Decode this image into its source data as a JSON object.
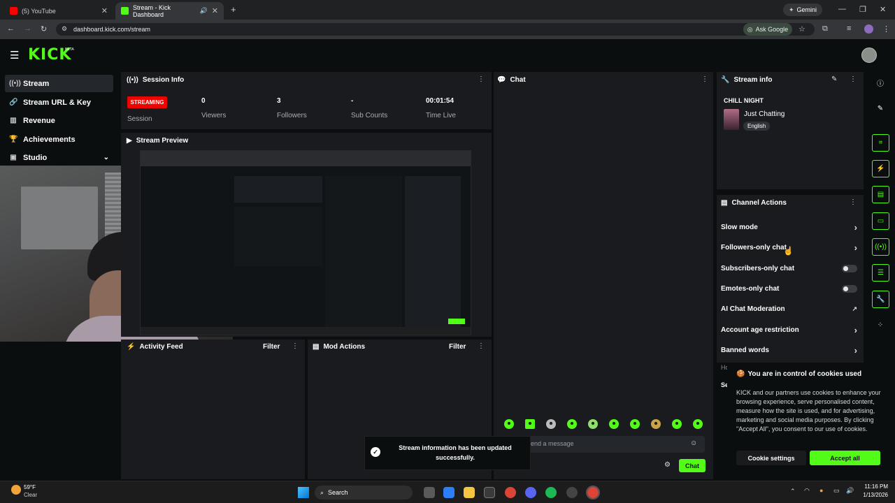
{
  "browser": {
    "tabs": [
      {
        "label": "(5) YouTube",
        "active": false
      },
      {
        "label": "Stream - Kick Dashboard",
        "active": true
      }
    ],
    "gemini_label": "Gemini",
    "url": "dashboard.kick.com/stream",
    "ask_google": "Ask Google"
  },
  "brand": {
    "logo": "KICK",
    "beta": "BETA",
    "accent": "#53fc18",
    "live_red": "#eb0400"
  },
  "sidebar": {
    "items": [
      {
        "label": "Stream",
        "icon": "broadcast-icon",
        "active": true
      },
      {
        "label": "Stream URL & Key",
        "icon": "link-icon",
        "active": false
      },
      {
        "label": "Revenue",
        "icon": "chart-icon",
        "active": false
      },
      {
        "label": "Achievements",
        "icon": "trophy-icon",
        "active": false
      },
      {
        "label": "Studio",
        "icon": "camera-icon",
        "active": false
      }
    ]
  },
  "session": {
    "title": "Session Info",
    "status_badge": "STREAMING",
    "status_label": "Session",
    "stats": [
      {
        "value": "0",
        "label": "Viewers"
      },
      {
        "value": "3",
        "label": "Followers"
      },
      {
        "value": "-",
        "label": "Sub Counts"
      },
      {
        "value": "00:01:54",
        "label": "Time Live"
      }
    ]
  },
  "preview": {
    "title": "Stream Preview"
  },
  "chat": {
    "title": "Chat",
    "input_placeholder": "end a message",
    "send_label": "Chat"
  },
  "activity_feed": {
    "title": "Activity Feed",
    "filter_label": "Filter"
  },
  "mod_actions": {
    "title": "Mod Actions",
    "filter_label": "Filter"
  },
  "stream_info": {
    "title": "Stream info",
    "stream_title": "CHILL NIGHT",
    "category": "Just Chatting",
    "language": "English"
  },
  "channel_actions": {
    "title": "Channel Actions",
    "rows": [
      {
        "label": "Slow mode",
        "control": "chevron"
      },
      {
        "label": "Followers-only chat",
        "control": "chevron"
      },
      {
        "label": "Subscribers-only chat",
        "control": "toggle"
      },
      {
        "label": "Emotes-only chat",
        "control": "toggle"
      },
      {
        "label": "AI Chat Moderation",
        "control": "external"
      },
      {
        "label": "Account age restriction",
        "control": "chevron"
      },
      {
        "label": "Banned words",
        "control": "chevron"
      }
    ],
    "partial_rows": [
      "Ho",
      "Se"
    ]
  },
  "toast": {
    "message": "Stream information has been updated successfully."
  },
  "cookie": {
    "title": "You are in control of cookies used",
    "body": "KICK and our partners use cookies to enhance your browsing experience, serve personalised content, measure how the site is used, and for advertising, marketing and social media purposes. By clicking \"Accept All\", you consent to our use of cookies.",
    "settings_label": "Cookie settings",
    "accept_label": "Accept all"
  },
  "taskbar": {
    "weather_temp": "59°F",
    "weather_desc": "Clear",
    "search_label": "Search",
    "time": "11:16 PM",
    "date": "1/13/2026"
  }
}
